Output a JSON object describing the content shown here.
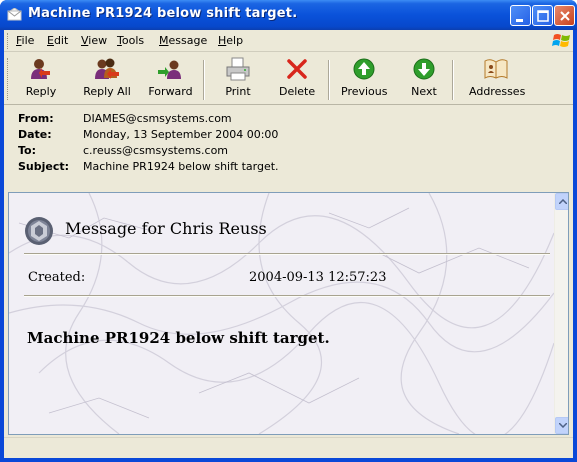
{
  "window": {
    "title": "Machine PR1924 below shift target."
  },
  "menu": [
    {
      "label": "File"
    },
    {
      "label": "Edit"
    },
    {
      "label": "View"
    },
    {
      "label": "Tools"
    },
    {
      "label": "Message"
    },
    {
      "label": "Help"
    }
  ],
  "toolbar": {
    "reply": "Reply",
    "reply_all": "Reply All",
    "forward": "Forward",
    "print": "Print",
    "delete": "Delete",
    "previous": "Previous",
    "next": "Next",
    "addresses": "Addresses"
  },
  "headers": {
    "from_label": "From:",
    "from": "DIAMES@csmsystems.com",
    "date_label": "Date:",
    "date": "Monday, 13 September 2004 00:00",
    "to_label": "To:",
    "to": "c.reuss@csmsystems.com",
    "subject_label": "Subject:",
    "subject": "Machine PR1924 below shift target."
  },
  "message": {
    "heading": "Message for Chris Reuss",
    "created_label": "Created:",
    "created_value": "2004-09-13 12:57:23",
    "body": "Machine PR1924 below shift target."
  },
  "colors": {
    "titlebar": "#0a52da",
    "chrome": "#ece9d8",
    "go_green": "#2f9e2c",
    "delete_red": "#d8261c"
  }
}
